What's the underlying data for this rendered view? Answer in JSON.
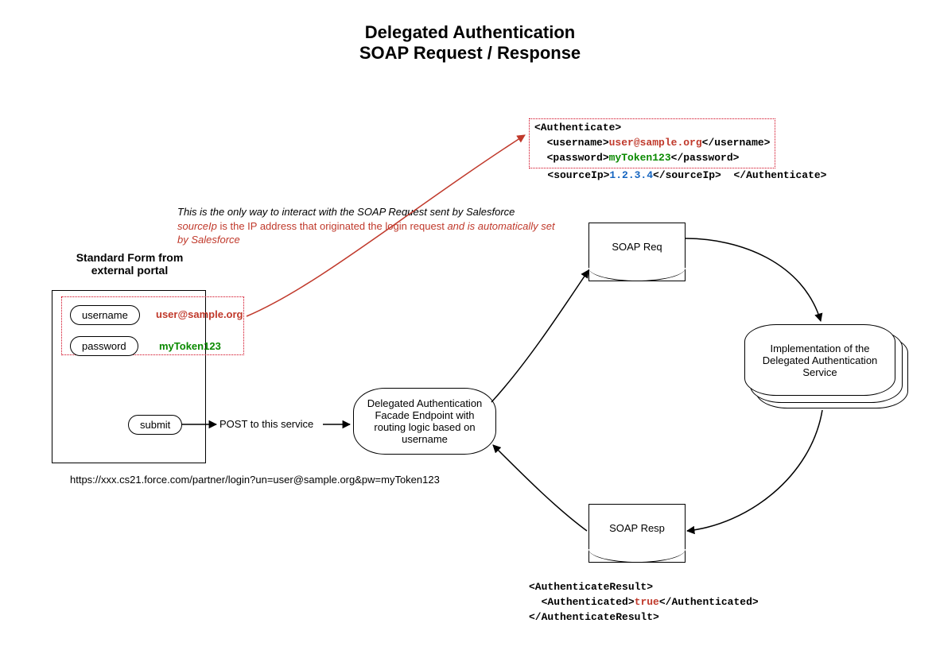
{
  "title_line1": "Delegated Authentication",
  "title_line2": "SOAP Request / Response",
  "note": {
    "line1": "This is the only way to interact with the SOAP Request sent by Salesforce",
    "src_lbl": "sourceIp",
    "line2a": " is the IP address that originated the login request ",
    "line2b": "and is automatically set by Salesforce"
  },
  "form": {
    "heading": "Standard Form from external portal",
    "username_lbl": "username",
    "password_lbl": "password",
    "username_val": "user@sample.org",
    "password_val": "myToken123",
    "submit_lbl": "submit",
    "post_url": "https://xxx.cs21.force.com/partner/login?un=user@sample.org&pw=myToken123"
  },
  "post_caption": "POST to this service",
  "facade": "Delegated Authentication Facade Endpoint with routing logic based on username",
  "soap_req_lbl": "SOAP Req",
  "soap_resp_lbl": "SOAP Resp",
  "impl": "Implementation of the Delegated Authentication Service",
  "req": {
    "auth_open": "<Authenticate>",
    "un_open": "<username>",
    "un_val": "user@sample.org",
    "un_close": "</username>",
    "pw_open": "<password>",
    "pw_val": "myToken123",
    "pw_close": "</password>",
    "ip_open": "<sourceIp>",
    "ip_val": "1.2.3.4",
    "ip_close": "</sourceIp>",
    "auth_close": "</Authenticate>"
  },
  "resp": {
    "ar_open": "<AuthenticateResult>",
    "a_open": "<Authenticated>",
    "a_val": "true",
    "a_close": "</Authenticated>",
    "ar_close": "</AuthenticateResult>"
  }
}
